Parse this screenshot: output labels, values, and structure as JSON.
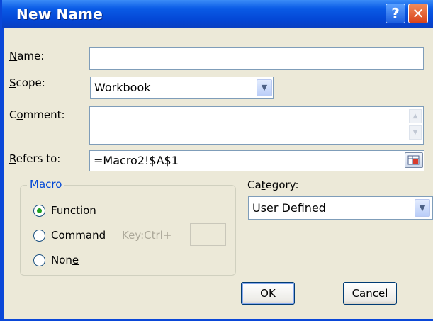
{
  "dialog": {
    "title": "New Name"
  },
  "titlebar": {
    "help_glyph": "?",
    "close_glyph": "✕"
  },
  "form": {
    "name": {
      "label": "Name:",
      "value": ""
    },
    "scope": {
      "label": "Scope:",
      "value": "Workbook"
    },
    "comment": {
      "label": "Comment:",
      "value": ""
    },
    "refers_to": {
      "label": "Refers to:",
      "value": "=Macro2!$A$1"
    }
  },
  "macro": {
    "legend": "Macro",
    "options": [
      {
        "label": "Function",
        "selected": true
      },
      {
        "label": "Command",
        "selected": false
      },
      {
        "label": "None",
        "selected": false
      }
    ],
    "shortcut_label": "Key:Ctrl+",
    "shortcut_value": ""
  },
  "category": {
    "label": "Category:",
    "value": "User Defined"
  },
  "buttons": {
    "ok": "OK",
    "cancel": "Cancel"
  },
  "colors": {
    "titlebar": "#0a47d8",
    "dialog_bg": "#ece9d8",
    "group_legend": "#0046d5",
    "radio_dot": "#21a121"
  }
}
